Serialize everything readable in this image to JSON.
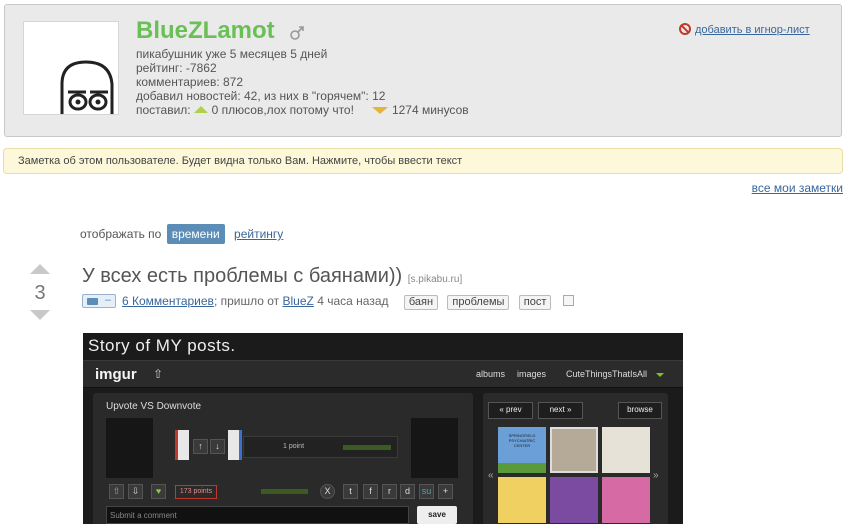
{
  "profile": {
    "username": "BlueZLamot",
    "member_for": "пикабушник уже 5 месяцев 5 дней",
    "rating": "рейтинг: -7862",
    "comments": "комментариев: 872",
    "news": "добавил новостей: 42, из них в \"горячем\": 12",
    "gave_prefix": "поставил:",
    "plus_text": "0 плюсов,лох потому что!",
    "minus_text": "1274 минусов",
    "ignore_link": "добавить в игнор-лист"
  },
  "note": {
    "text": "Заметка об этом пользователе. Будет видна только Вам. Нажмите, чтобы ввести текст",
    "all_notes_link": "все мои заметки"
  },
  "sort": {
    "label": "отображать по",
    "active": "времени",
    "other": "рейтингу"
  },
  "post": {
    "score": "3",
    "title": "У всех есть проблемы с баянами))",
    "source": "[s.pikabu.ru]",
    "camera_dash": "–",
    "comments_link": "6 Комментариев",
    "came_from": "; пришло от",
    "author_link": "BlueZ",
    "time": "4 часа назад",
    "tags": [
      "баян",
      "проблемы",
      "пост"
    ]
  },
  "image": {
    "caption": "Story of MY posts.",
    "logo": "imgur",
    "nav": [
      "albums",
      "images",
      "CuteThingsThatIsAll"
    ],
    "panel_title": "Upvote VS Downvote",
    "point_text": "1 point",
    "points_box": "173 points",
    "comment_placeholder": "Submit a comment",
    "save_label": "save",
    "prev_label": "« prev",
    "next_label": "next »",
    "browse_label": "browse",
    "thumb_text": "SPRINGFIELD PSYCHIATRIC CENTER",
    "share_icons": [
      "X",
      "t",
      "f",
      "r",
      "d",
      "su",
      "+"
    ]
  },
  "colors": {
    "username": "#6bbf57",
    "link": "#38669b",
    "sort_active_bg": "#5b8db7",
    "note_bg": "#fdf8d9",
    "plus_arrow": "#b0cf4b",
    "minus_arrow": "#e7b43b"
  }
}
